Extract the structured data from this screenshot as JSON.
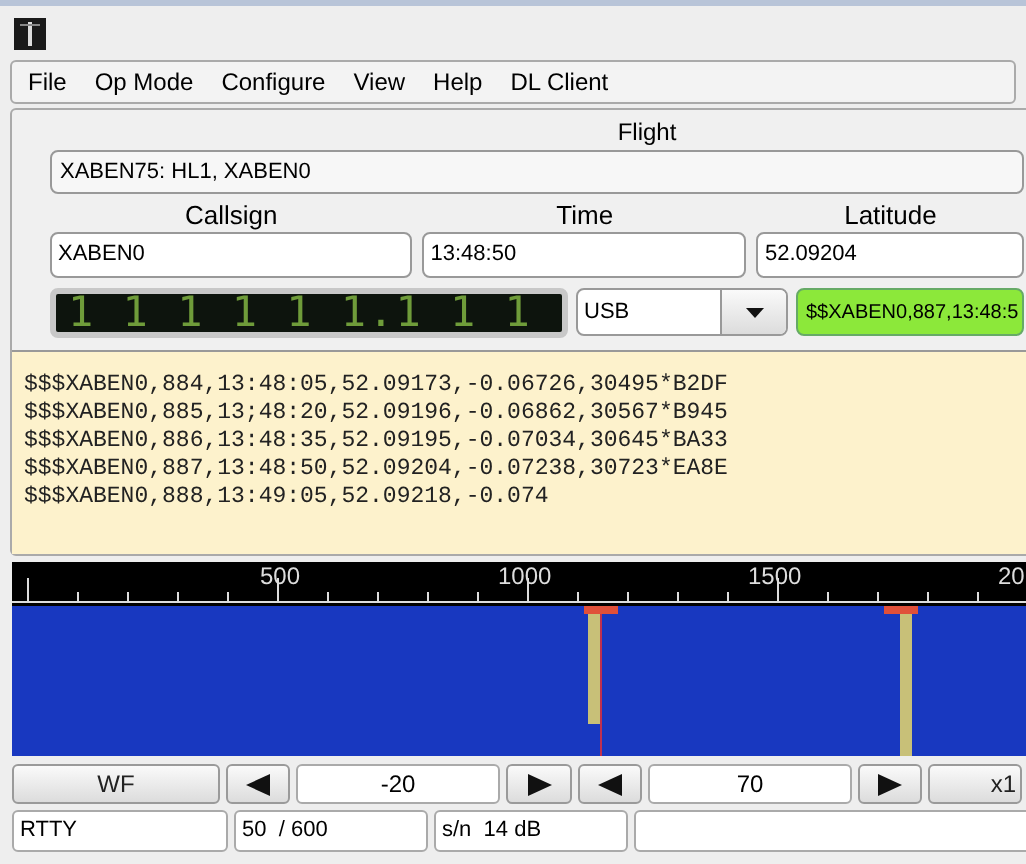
{
  "menu": [
    "File",
    "Op Mode",
    "Configure",
    "View",
    "Help",
    "DL Client"
  ],
  "flight": {
    "label": "Flight",
    "value": "XABEN75: HL1, XABEN0"
  },
  "fields": [
    {
      "label": "Callsign",
      "value": "XABEN0"
    },
    {
      "label": "Time",
      "value": "13:48:50"
    },
    {
      "label": "Latitude",
      "value": "52.09204"
    }
  ],
  "frequency": "1 1 1 1 1 1.1 1 1",
  "mode": {
    "value": "USB"
  },
  "sentence": "$$XABEN0,887,13:48:5",
  "log": [
    "$$$XABEN0,884,13:48:05,52.09173,-0.06726,30495*B2DF",
    "$$$XABEN0,885,13;48:20,52.09196,-0.06862,30567*B945",
    "$$$XABEN0,886,13:48:35,52.09195,-0.07034,30645*BA33",
    "$$$XABEN0,887,13:48:50,52.09204,-0.07238,30723*EA8E",
    "$$$XABEN0,888,13:49:05,52.09218,-0.074"
  ],
  "ruler": [
    "500",
    "1000",
    "1500",
    "20"
  ],
  "controls": {
    "waterfall_button": "WF",
    "gain": "-20",
    "range": "70",
    "zoom_button": "x1"
  },
  "status": [
    "RTTY",
    "50  / 600",
    "s/n  14 dB"
  ]
}
